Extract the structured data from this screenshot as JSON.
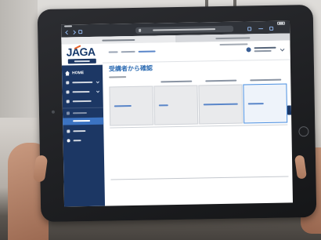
{
  "app": {
    "logo": "JAGA"
  },
  "sidebar": {
    "home_label": "HOME"
  },
  "main": {
    "title": "受講者から確認"
  },
  "colors": {
    "sidebar": "#1c3764",
    "accent": "#2f6db3",
    "sidebar_selected": "#3b73c2",
    "selected_cell_border": "#4a8fe0",
    "browser_chrome": "#2f3238",
    "bezel": "#1e1f22"
  },
  "icons": [
    "back-icon",
    "forward-icon",
    "bookmarks-icon",
    "lock-icon",
    "share-icon",
    "new-tab-icon",
    "tabs-icon",
    "battery-icon",
    "user-icon",
    "chevron-down-icon",
    "home-icon",
    "help-icon"
  ]
}
